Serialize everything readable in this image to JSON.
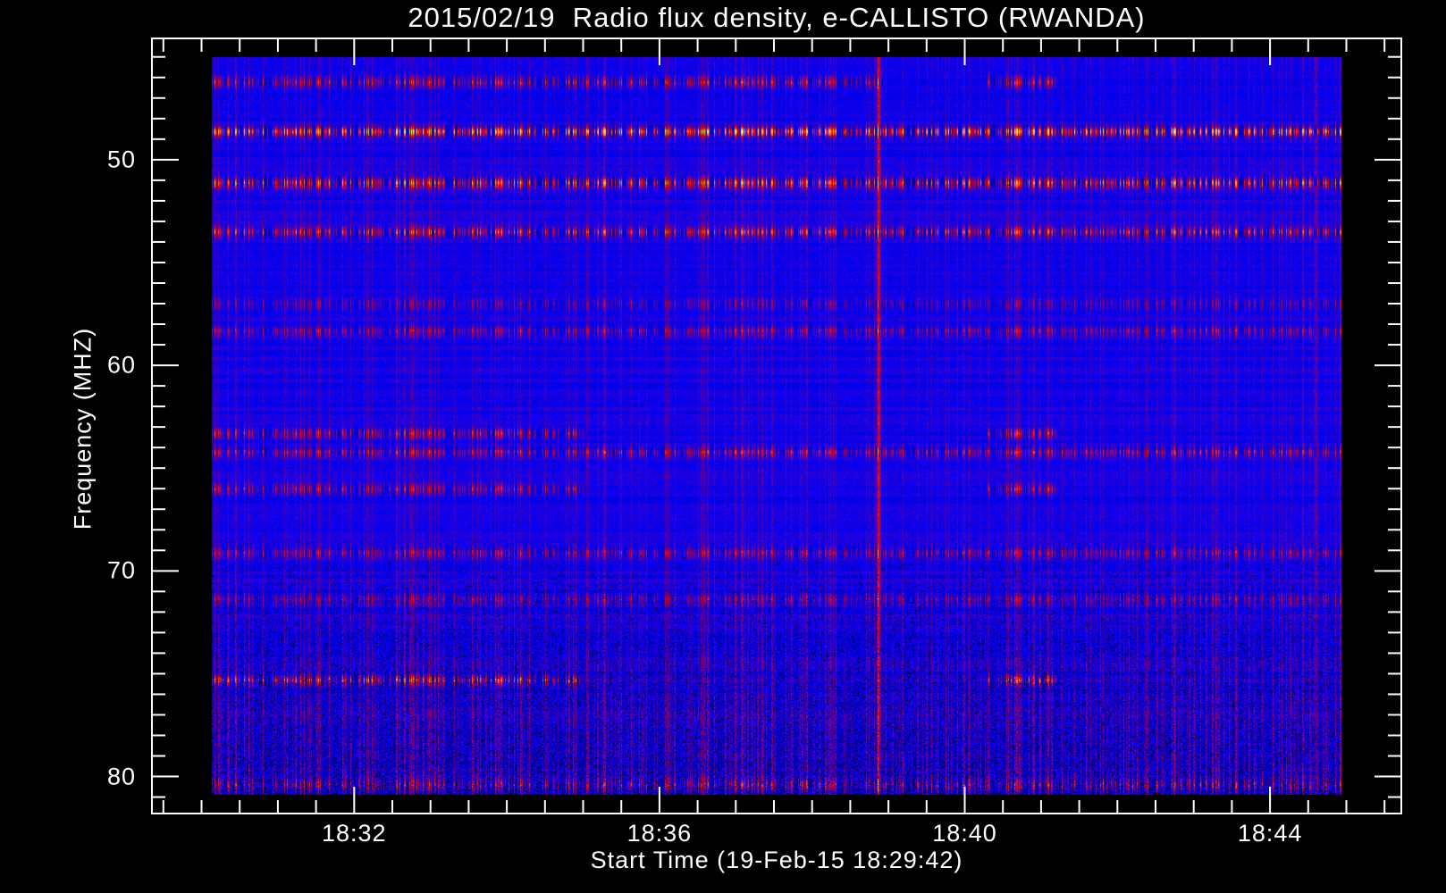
{
  "chart_data": {
    "type": "heatmap",
    "title": "2015/02/19  Radio flux density, e-CALLISTO (RWANDA)",
    "xlabel": "Start Time (19-Feb-15 18:29:42)",
    "ylabel": "Frequency (MHZ)",
    "x_unit": "minutes after 18:00",
    "xlim": [
      29.35,
      45.72
    ],
    "ylim": [
      81.8,
      44.1
    ],
    "data_extent": {
      "x": [
        30.13,
        44.94
      ],
      "y": [
        45.0,
        80.9
      ]
    },
    "x_ticks": [
      {
        "value": 32,
        "label": "18:32"
      },
      {
        "value": 36,
        "label": "18:36"
      },
      {
        "value": 40,
        "label": "18:40"
      },
      {
        "value": 44,
        "label": "18:44"
      }
    ],
    "x_minor_step": 0.5,
    "y_ticks": [
      {
        "value": 50,
        "label": "50"
      },
      {
        "value": 60,
        "label": "60"
      },
      {
        "value": 70,
        "label": "70"
      },
      {
        "value": 80,
        "label": "80"
      }
    ],
    "y_minor_step": 1,
    "colormap": [
      "#000000",
      "#0000ff",
      "#ff0000",
      "#ffa000",
      "#ffff60"
    ],
    "bright_bands_mhz": [
      {
        "f": 46.2,
        "strength": 0.35,
        "until": 38.9
      },
      {
        "f": 48.6,
        "strength": 0.55
      },
      {
        "f": 51.1,
        "strength": 0.5
      },
      {
        "f": 53.5,
        "strength": 0.4
      },
      {
        "f": 57.0,
        "strength": 0.2
      },
      {
        "f": 58.3,
        "strength": 0.25
      },
      {
        "f": 63.3,
        "strength": 0.35,
        "until": 35.0
      },
      {
        "f": 64.2,
        "strength": 0.3
      },
      {
        "f": 66.0,
        "strength": 0.3,
        "until": 35.0
      },
      {
        "f": 69.1,
        "strength": 0.25
      },
      {
        "f": 71.4,
        "strength": 0.2
      },
      {
        "f": 75.3,
        "strength": 0.35,
        "until": 35.0
      },
      {
        "f": 80.4,
        "strength": 0.2
      }
    ],
    "bright_times": [
      {
        "t": 38.87,
        "strength": 0.35
      },
      {
        "t": 44.6,
        "strength": 0.15
      }
    ],
    "grid": false
  }
}
